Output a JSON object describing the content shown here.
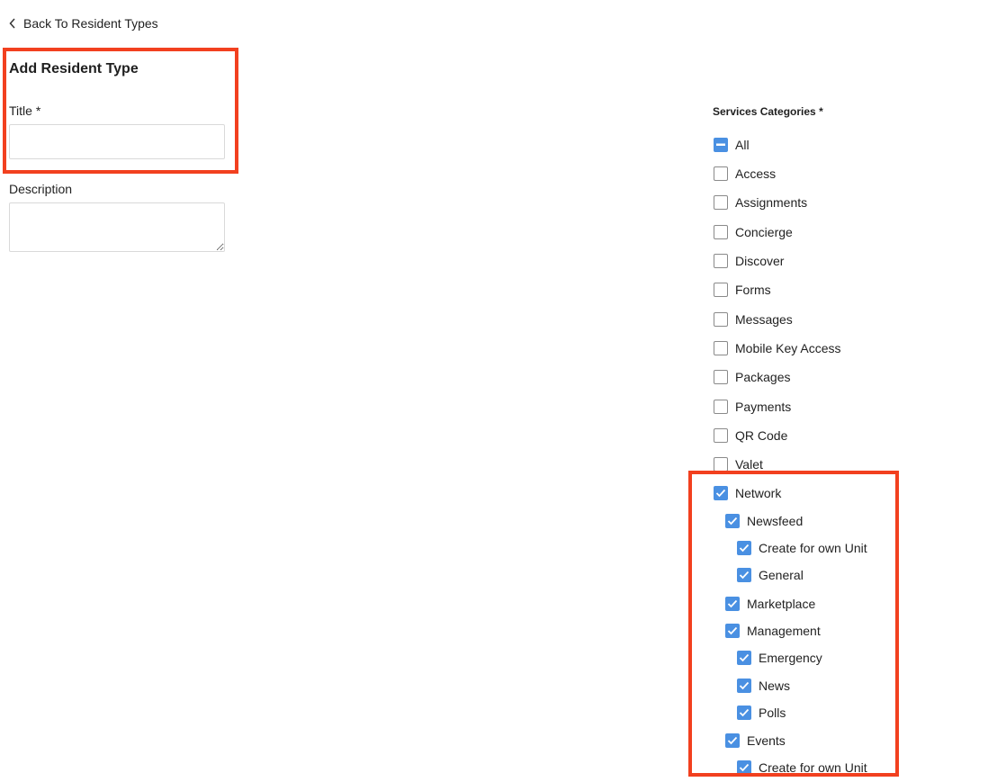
{
  "back_link": {
    "label": "Back To Resident Types",
    "icon": "chevron-left-icon"
  },
  "form": {
    "heading": "Add Resident Type",
    "title_label": "Title *",
    "title_value": "",
    "description_label": "Description",
    "description_value": ""
  },
  "services": {
    "heading": "Services Categories *",
    "items": [
      {
        "label": "All",
        "state": "indeterminate",
        "level": 0
      },
      {
        "label": "Access",
        "state": "unchecked",
        "level": 0
      },
      {
        "label": "Assignments",
        "state": "unchecked",
        "level": 0
      },
      {
        "label": "Concierge",
        "state": "unchecked",
        "level": 0
      },
      {
        "label": "Discover",
        "state": "unchecked",
        "level": 0
      },
      {
        "label": "Forms",
        "state": "unchecked",
        "level": 0
      },
      {
        "label": "Messages",
        "state": "unchecked",
        "level": 0
      },
      {
        "label": "Mobile Key Access",
        "state": "unchecked",
        "level": 0
      },
      {
        "label": "Packages",
        "state": "unchecked",
        "level": 0
      },
      {
        "label": "Payments",
        "state": "unchecked",
        "level": 0
      },
      {
        "label": "QR Code",
        "state": "unchecked",
        "level": 0
      },
      {
        "label": "Valet",
        "state": "unchecked",
        "level": 0
      },
      {
        "label": "Network",
        "state": "checked",
        "level": 0
      },
      {
        "label": "Newsfeed",
        "state": "checked",
        "level": 1
      },
      {
        "label": "Create for own Unit",
        "state": "checked",
        "level": 2
      },
      {
        "label": "General",
        "state": "checked",
        "level": 2
      },
      {
        "label": "Marketplace",
        "state": "checked",
        "level": 1
      },
      {
        "label": "Management",
        "state": "checked",
        "level": 1
      },
      {
        "label": "Emergency",
        "state": "checked",
        "level": 2
      },
      {
        "label": "News",
        "state": "checked",
        "level": 2
      },
      {
        "label": "Polls",
        "state": "checked",
        "level": 2
      },
      {
        "label": "Events",
        "state": "checked",
        "level": 1
      },
      {
        "label": "Create for own Unit",
        "state": "checked",
        "level": 2
      }
    ]
  },
  "colors": {
    "checkbox_checked": "#4a90e2",
    "highlight": "#f2401f"
  }
}
